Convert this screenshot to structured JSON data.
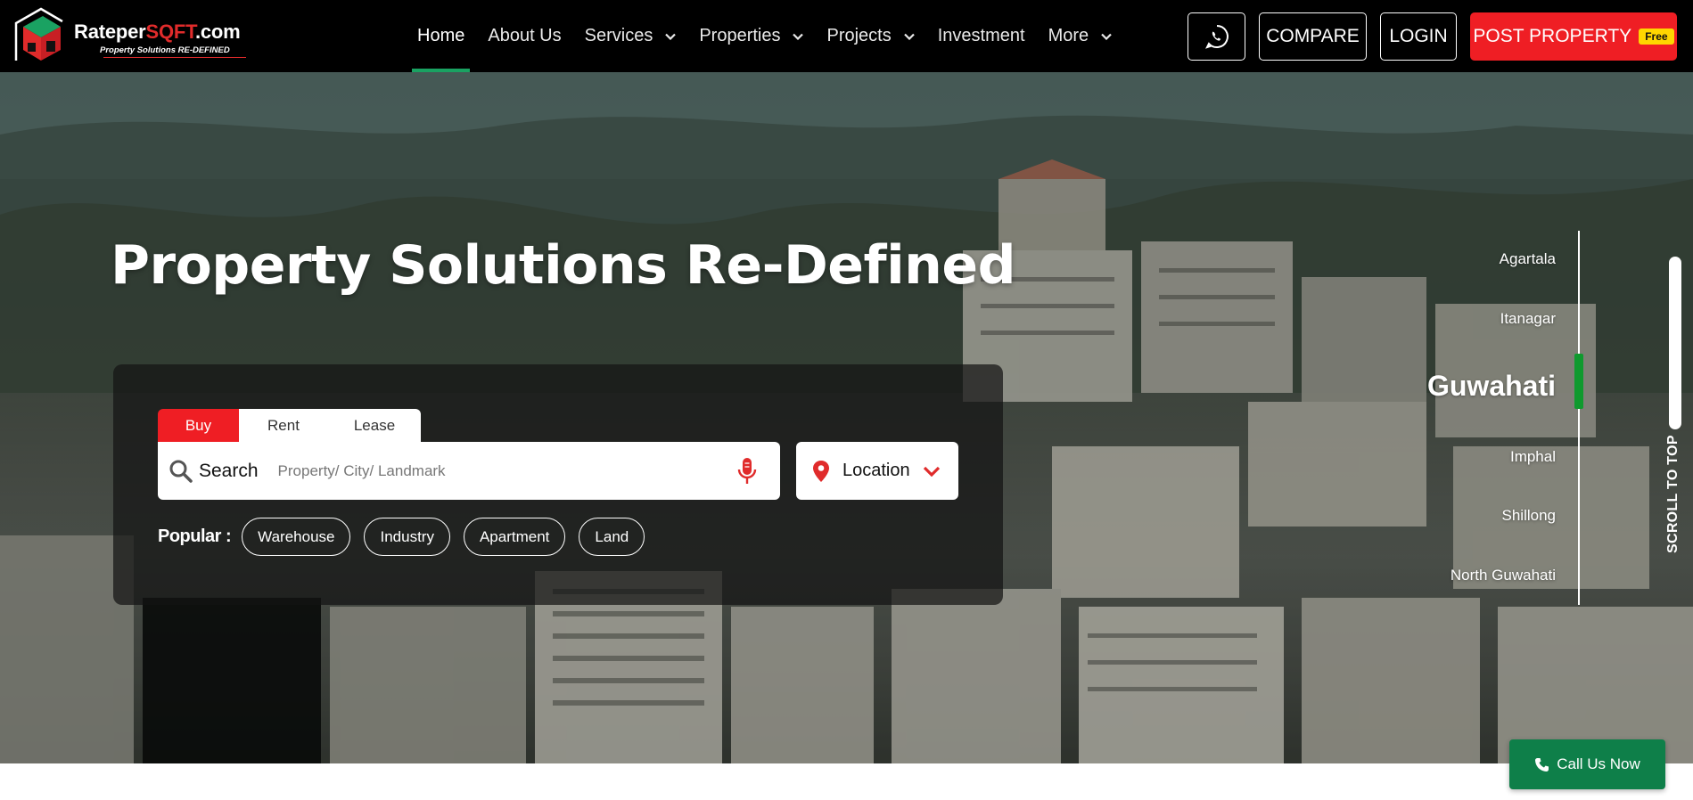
{
  "brand": {
    "name_prefix": "Rateper",
    "name_highlight": "SQFT",
    "name_suffix": ".com",
    "tagline": "Property Solutions RE-DEFINED",
    "logo_icon": "house-cube-logo",
    "colors": {
      "red": "#e02b2b",
      "green": "#1aa262"
    }
  },
  "nav": {
    "items": [
      {
        "label": "Home",
        "active": true,
        "dropdown": false
      },
      {
        "label": "About Us",
        "active": false,
        "dropdown": false
      },
      {
        "label": "Services",
        "active": false,
        "dropdown": true
      },
      {
        "label": "Properties",
        "active": false,
        "dropdown": true
      },
      {
        "label": "Projects",
        "active": false,
        "dropdown": true
      },
      {
        "label": "Investment",
        "active": false,
        "dropdown": false
      },
      {
        "label": "More",
        "active": false,
        "dropdown": true
      }
    ],
    "whatsapp_icon": "whatsapp-icon",
    "compare_label": "COMPARE",
    "login_label": "LOGIN",
    "post_label": "POST PROPERTY",
    "free_badge": "Free",
    "accent_color": "#ef1e24"
  },
  "hero": {
    "title": "Property Solutions Re-Defined",
    "tabs": [
      "Buy",
      "Rent",
      "Lease"
    ],
    "active_tab": "Buy",
    "search_label": "Search",
    "search_placeholder": "Property/ City/ Landmark",
    "search_value": "",
    "mic_icon": "microphone-icon",
    "location_label": "Location",
    "popular_label": "Popular :",
    "popular_chips": [
      "Warehouse",
      "Industry",
      "Apartment",
      "Land"
    ]
  },
  "cities": {
    "items": [
      "Agartala",
      "Itanagar",
      "Guwahati",
      "Imphal",
      "Shillong",
      "North Guwahati"
    ],
    "active": "Guwahati",
    "active_color": "#0f9a2e"
  },
  "scroll_to_top_label": "SCROLL TO TOP",
  "call_button_label": "Call Us Now",
  "call_button_color": "#0e7f49"
}
